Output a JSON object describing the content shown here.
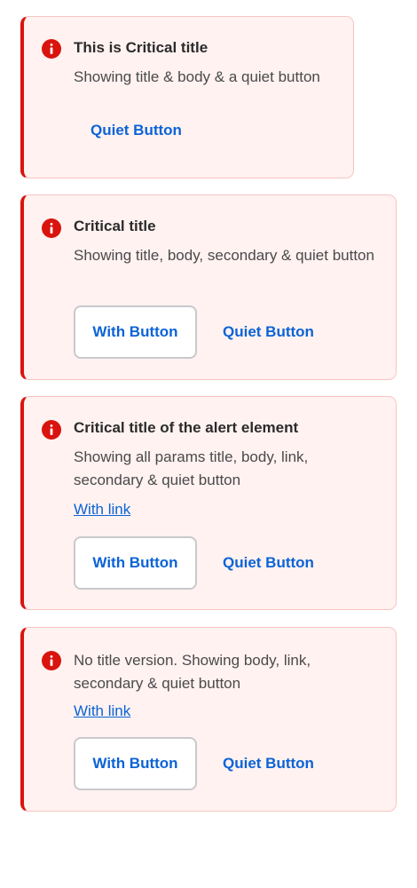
{
  "colors": {
    "critical": "#d9140e",
    "alert_background": "#fff2f1",
    "alert_border": "#f7c5c2",
    "action_text": "#0b63d6"
  },
  "alerts": [
    {
      "icon": "critical-info-icon",
      "title": "This is Critical title",
      "body": "Showing title & body & a quiet button",
      "quiet_button": "Quiet Button"
    },
    {
      "icon": "critical-info-icon",
      "title": "Critical title",
      "body": "Showing title, body, secondary & quiet button",
      "secondary_button": "With Button",
      "quiet_button": "Quiet Button"
    },
    {
      "icon": "critical-info-icon",
      "title": "Critical title of the alert element",
      "body": "Showing all params title, body, link, secondary & quiet button",
      "link": "With link",
      "secondary_button": "With Button",
      "quiet_button": "Quiet Button"
    },
    {
      "icon": "critical-info-icon",
      "body": "No title version. Showing body, link, secondary & quiet button",
      "link": "With link",
      "secondary_button": "With Button",
      "quiet_button": "Quiet Button"
    }
  ]
}
